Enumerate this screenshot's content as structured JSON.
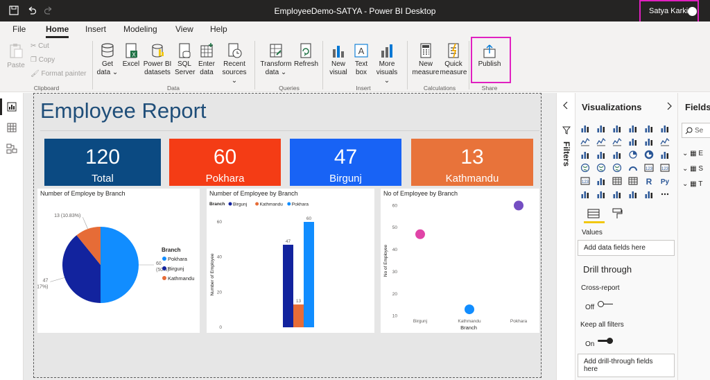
{
  "window": {
    "title": "EmployeeDemo-SATYA - Power BI Desktop",
    "user": "Satya Karki"
  },
  "tabs": [
    {
      "label": "File"
    },
    {
      "label": "Home"
    },
    {
      "label": "Insert"
    },
    {
      "label": "Modeling"
    },
    {
      "label": "View"
    },
    {
      "label": "Help"
    }
  ],
  "ribbon": {
    "clipboard": {
      "paste": "Paste",
      "cut": "Cut",
      "copy": "Copy",
      "format_painter": "Format painter",
      "label": "Clipboard"
    },
    "data": {
      "get_data_1": "Get",
      "get_data_2": "data",
      "excel": "Excel",
      "pbi_1": "Power BI",
      "pbi_2": "datasets",
      "sql_1": "SQL",
      "sql_2": "Server",
      "enter_1": "Enter",
      "enter_2": "data",
      "recent_1": "Recent",
      "recent_2": "sources",
      "label": "Data"
    },
    "queries": {
      "transform_1": "Transform",
      "transform_2": "data",
      "refresh": "Refresh",
      "label": "Queries"
    },
    "insert": {
      "newvisual_1": "New",
      "newvisual_2": "visual",
      "textbox_1": "Text",
      "textbox_2": "box",
      "more_1": "More",
      "more_2": "visuals",
      "label": "Insert"
    },
    "calculations": {
      "newmeasure_1": "New",
      "newmeasure_2": "measure",
      "quick_1": "Quick",
      "quick_2": "measure",
      "label": "Calculations"
    },
    "share": {
      "publish": "Publish",
      "label": "Share"
    }
  },
  "report": {
    "title": "Employee Report",
    "kpis": [
      {
        "value": "120",
        "label": "Total",
        "color": "#0b4a82"
      },
      {
        "value": "60",
        "label": "Pokhara",
        "color": "#f43c15"
      },
      {
        "value": "47",
        "label": "Birgunj",
        "color": "#1863f5"
      },
      {
        "value": "13",
        "label": "Kathmandu",
        "color": "#e8733a"
      }
    ]
  },
  "chart_data": [
    {
      "type": "pie",
      "title": "Number of Employe by Branch",
      "legend_title": "Branch",
      "legend_position": "right",
      "slices": [
        {
          "name": "Pokhara",
          "value": 60,
          "label": "60",
          "pct": "(50%)",
          "color": "#118dff"
        },
        {
          "name": "Birgunj",
          "value": 47,
          "label": "47",
          "pct": "(39.17%)",
          "color": "#12239e"
        },
        {
          "name": "Kathmandu",
          "value": 13,
          "label": "13 (10.83%)",
          "pct": "",
          "color": "#e66c37"
        }
      ]
    },
    {
      "type": "bar",
      "title": "Number of Employee by Branch",
      "legend_title": "Branch",
      "legend_position": "top-left",
      "series": [
        {
          "name": "Birgunj",
          "values": [
            47
          ],
          "color": "#12239e"
        },
        {
          "name": "Kathmandu",
          "values": [
            13
          ],
          "color": "#e66c37"
        },
        {
          "name": "Pokhara",
          "values": [
            60
          ],
          "color": "#118dff"
        }
      ],
      "ylabel": "Number of Employee",
      "ylim": [
        0,
        60
      ],
      "yticks": [
        "0",
        "20",
        "40",
        "60"
      ],
      "data_labels": [
        "47",
        "13",
        "60"
      ]
    },
    {
      "type": "scatter",
      "title": "No of Employee by Branch",
      "points": [
        {
          "x": "Birgunj",
          "y": 47,
          "color": "#e044a7"
        },
        {
          "x": "Kathmandu",
          "y": 13,
          "color": "#118dff"
        },
        {
          "x": "Pokhara",
          "y": 60,
          "color": "#744ec2"
        }
      ],
      "xlabel": "Branch",
      "ylabel": "No of Employee",
      "ylim": [
        8,
        62
      ],
      "yticks": [
        "10",
        "20",
        "30",
        "40",
        "50",
        "60"
      ]
    }
  ],
  "filters": {
    "label": "Filters"
  },
  "visualizations": {
    "title": "Visualizations",
    "values_label": "Values",
    "values_placeholder": "Add data fields here",
    "drill_title": "Drill through",
    "cross_report": "Cross-report",
    "cross_report_state": "Off",
    "keep_filters": "Keep all filters",
    "keep_filters_state": "On",
    "drill_placeholder": "Add drill-through fields here"
  },
  "fields": {
    "title": "Fields",
    "search_placeholder": "Se",
    "tables": [
      "E",
      "S",
      "T"
    ]
  },
  "colors": {
    "accent_highlight": "#e020c0",
    "title_blue": "#1f4e79"
  }
}
